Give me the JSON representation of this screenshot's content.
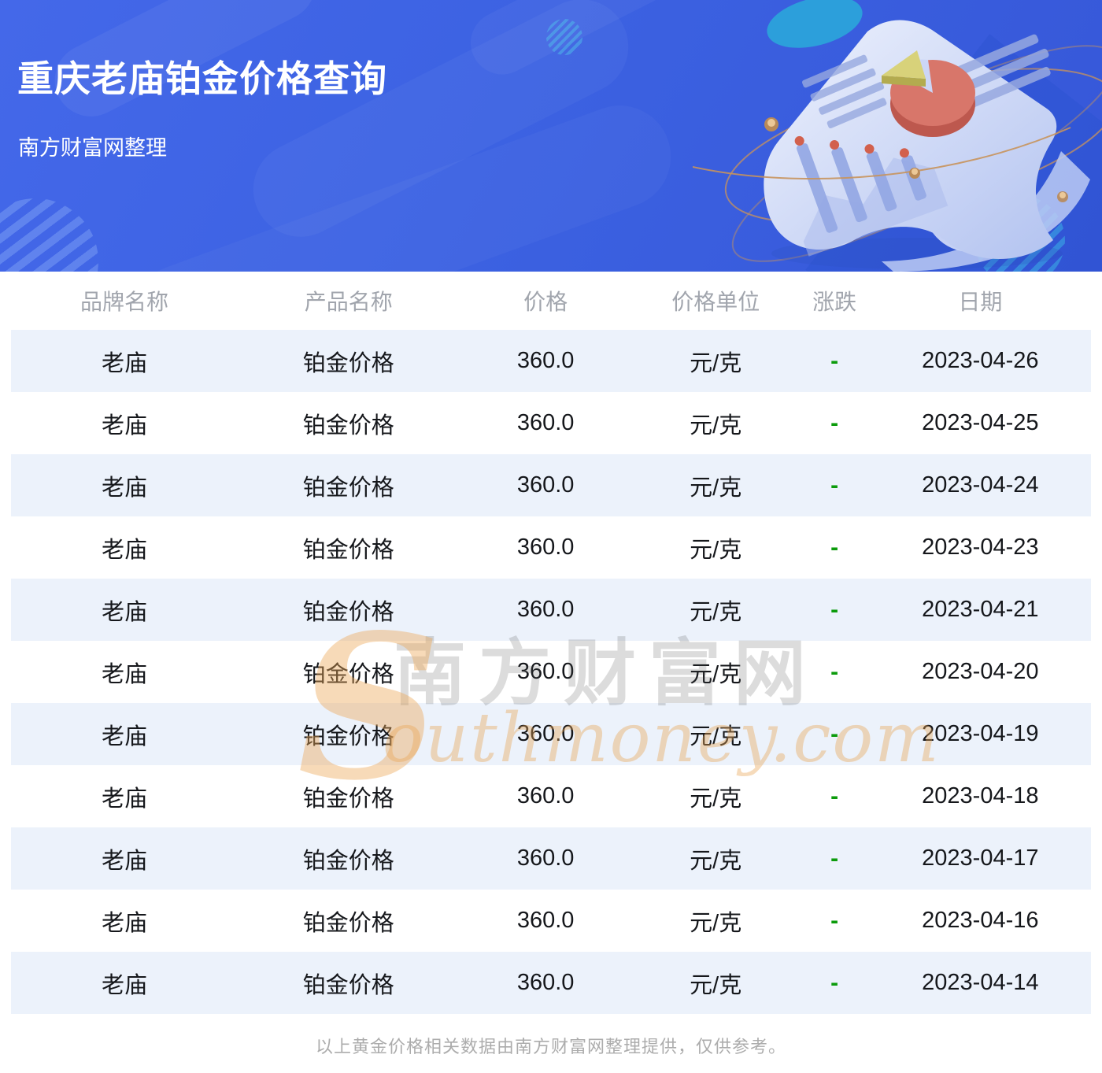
{
  "banner": {
    "title": "重庆老庙铂金价格查询",
    "subtitle": "南方财富网整理"
  },
  "watermark": {
    "initial": "S",
    "cn": "南方财富网",
    "en": "outhmoney.com"
  },
  "table": {
    "columns": [
      {
        "key": "brand",
        "label": "品牌名称"
      },
      {
        "key": "product",
        "label": "产品名称"
      },
      {
        "key": "price",
        "label": "价格"
      },
      {
        "key": "unit",
        "label": "价格单位"
      },
      {
        "key": "change",
        "label": "涨跌"
      },
      {
        "key": "date",
        "label": "日期"
      }
    ],
    "rows": [
      {
        "brand": "老庙",
        "product": "铂金价格",
        "price": "360.0",
        "unit": "元/克",
        "change": "-",
        "date": "2023-04-26"
      },
      {
        "brand": "老庙",
        "product": "铂金价格",
        "price": "360.0",
        "unit": "元/克",
        "change": "-",
        "date": "2023-04-25"
      },
      {
        "brand": "老庙",
        "product": "铂金价格",
        "price": "360.0",
        "unit": "元/克",
        "change": "-",
        "date": "2023-04-24"
      },
      {
        "brand": "老庙",
        "product": "铂金价格",
        "price": "360.0",
        "unit": "元/克",
        "change": "-",
        "date": "2023-04-23"
      },
      {
        "brand": "老庙",
        "product": "铂金价格",
        "price": "360.0",
        "unit": "元/克",
        "change": "-",
        "date": "2023-04-21"
      },
      {
        "brand": "老庙",
        "product": "铂金价格",
        "price": "360.0",
        "unit": "元/克",
        "change": "-",
        "date": "2023-04-20"
      },
      {
        "brand": "老庙",
        "product": "铂金价格",
        "price": "360.0",
        "unit": "元/克",
        "change": "-",
        "date": "2023-04-19"
      },
      {
        "brand": "老庙",
        "product": "铂金价格",
        "price": "360.0",
        "unit": "元/克",
        "change": "-",
        "date": "2023-04-18"
      },
      {
        "brand": "老庙",
        "product": "铂金价格",
        "price": "360.0",
        "unit": "元/克",
        "change": "-",
        "date": "2023-04-17"
      },
      {
        "brand": "老庙",
        "product": "铂金价格",
        "price": "360.0",
        "unit": "元/克",
        "change": "-",
        "date": "2023-04-16"
      },
      {
        "brand": "老庙",
        "product": "铂金价格",
        "price": "360.0",
        "unit": "元/克",
        "change": "-",
        "date": "2023-04-14"
      }
    ]
  },
  "footer": {
    "note": "以上黄金价格相关数据由南方财富网整理提供，仅供参考。"
  },
  "colors": {
    "banner_blue": "#3C62E2",
    "row_alt_blue": "#ECF2FB",
    "change_green": "#0B9B0B",
    "header_text_gray": "#A1A5AD",
    "footer_gray": "#ACACAC",
    "watermark_orange": "#E9A656",
    "pie_red": "#D8766A",
    "pie_yellow": "#D8D27A"
  }
}
